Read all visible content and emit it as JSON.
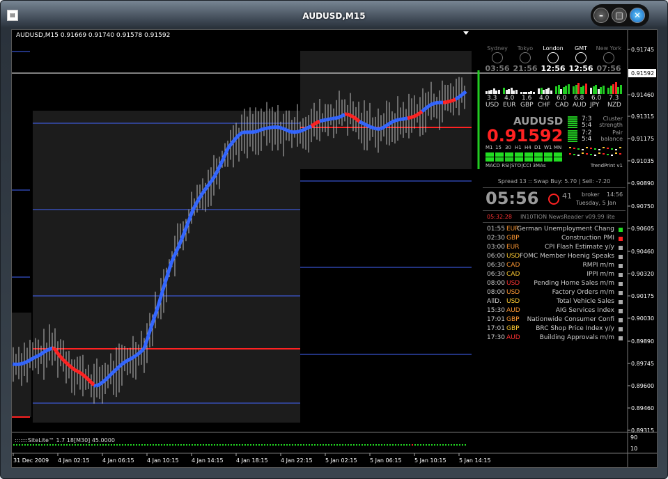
{
  "window": {
    "title": "AUDUSD,M15",
    "icon": "chart-window-icon"
  },
  "chart": {
    "header": "AUDUSD,M15  0.91669 0.91740 0.91578 0.91592",
    "price_labels": [
      "0.91745",
      "0.91592",
      "0.91460",
      "0.91315",
      "0.91175",
      "0.91035",
      "0.90890",
      "0.90750",
      "0.90605",
      "0.90460",
      "0.90320",
      "0.90175",
      "0.90030",
      "0.89890",
      "0.89745",
      "0.89600",
      "0.89460",
      "0.89315"
    ],
    "current_price": "0.91592",
    "time_labels": [
      "31 Dec 2009",
      "4 Jan 02:15",
      "4 Jan 06:15",
      "4 Jan 10:15",
      "4 Jan 14:15",
      "4 Jan 18:15",
      "4 Jan 22:15",
      "5 Jan 02:15",
      "5 Jan 06:15",
      "5 Jan 10:15",
      "5 Jan 14:15"
    ],
    "indicator": {
      "label": ":::::::SiteLite™ 1.7 18[M30] 45.0000",
      "levels": [
        "90",
        "10"
      ]
    }
  },
  "panel": {
    "sessions": [
      {
        "name": "Sydney",
        "time": "03:56",
        "active": false
      },
      {
        "name": "Tokyo",
        "time": "21:56",
        "active": false
      },
      {
        "name": "London",
        "time": "12:56",
        "active": true
      },
      {
        "name": "GMT",
        "time": "12:56",
        "active": true
      },
      {
        "name": "New York",
        "time": "07:56",
        "active": false
      }
    ],
    "currencies": [
      {
        "code": "USD",
        "value": "3.3"
      },
      {
        "code": "EUR",
        "value": "4.0"
      },
      {
        "code": "GBP",
        "value": "1.6"
      },
      {
        "code": "CHF",
        "value": "4.0"
      },
      {
        "code": "CAD",
        "value": "6.0"
      },
      {
        "code": "AUD",
        "value": "6.8"
      },
      {
        "code": "JPY",
        "value": "6.0"
      },
      {
        "code": "NZD",
        "value": "7.3"
      }
    ],
    "symbol": "AUDUSD",
    "bid": "0.91592",
    "cluster": {
      "r1": "7:3",
      "r2": "5:4",
      "label1": "Cluster",
      "label2": "strength"
    },
    "pair": {
      "r1": "7:2",
      "r2": "5:4",
      "label1": "Pair",
      "label2": "balance"
    },
    "tf_labels": [
      "M1",
      "15",
      "30",
      "H1",
      "H4",
      "D1",
      "W1",
      "MN"
    ],
    "ind_labels": "MACD  RSI|STO|CCI  3MAs",
    "trendprint": "TrendPrint v1",
    "spread": "Spread 13 :: Swap Buy: 5.70 | Sell: -7.20",
    "clock": {
      "time": "05:56",
      "seconds": "41",
      "broker": "broker",
      "broker_time": "14:56",
      "date": "Tuesday, 5 Jan"
    },
    "news_header": {
      "countdown": "05:32:28",
      "title": "IN10TION NewsReader v09.99 lite"
    },
    "news": [
      {
        "time": "01:55",
        "cur": "EUR",
        "event": "German Unemployment Chang",
        "cur_color": "#ff9933",
        "dot": "#22dd22"
      },
      {
        "time": "02:30",
        "cur": "GBP",
        "event": "Construction PMI",
        "cur_color": "#ff9933",
        "dot": "#ff2222"
      },
      {
        "time": "03:00",
        "cur": "EUR",
        "event": "CPI Flash Estimate y/y",
        "cur_color": "#ff9933",
        "dot": "#aaaaaa"
      },
      {
        "time": "06:00",
        "cur": "USD",
        "event": "FOMC Member Hoenig Speaks",
        "cur_color": "#ffcc33",
        "dot": "#aaaaaa"
      },
      {
        "time": "06:30",
        "cur": "CAD",
        "event": "RMPI m/m",
        "cur_color": "#ff9933",
        "dot": "#aaaaaa"
      },
      {
        "time": "06:30",
        "cur": "CAD",
        "event": "IPPI m/m",
        "cur_color": "#ffcc33",
        "dot": "#aaaaaa"
      },
      {
        "time": "08:00",
        "cur": "USD",
        "event": "Pending Home Sales m/m",
        "cur_color": "#ff3333",
        "dot": "#aaaaaa"
      },
      {
        "time": "08:00",
        "cur": "USD",
        "event": "Factory Orders m/m",
        "cur_color": "#ff9933",
        "dot": "#aaaaaa"
      },
      {
        "time": "AllD.",
        "cur": "USD",
        "event": "Total Vehicle Sales",
        "cur_color": "#ffcc33",
        "dot": "#aaaaaa"
      },
      {
        "time": "15:30",
        "cur": "AUD",
        "event": "AIG Services Index",
        "cur_color": "#ff9933",
        "dot": "#aaaaaa"
      },
      {
        "time": "17:01",
        "cur": "GBP",
        "event": "Nationwide Consumer Confi",
        "cur_color": "#ff9933",
        "dot": "#aaaaaa"
      },
      {
        "time": "17:01",
        "cur": "GBP",
        "event": "BRC Shop Price Index y/y",
        "cur_color": "#ffcc33",
        "dot": "#aaaaaa"
      },
      {
        "time": "17:30",
        "cur": "AUD",
        "event": "Building Approvals m/m",
        "cur_color": "#ff3333",
        "dot": "#aaaaaa"
      }
    ]
  },
  "colors": {
    "bull": "#3366ff",
    "bear": "#ff2222",
    "candle": "#c8c8c8",
    "level": "#4466ff",
    "pivot": "#ff2222",
    "ask": "#ffffff"
  }
}
